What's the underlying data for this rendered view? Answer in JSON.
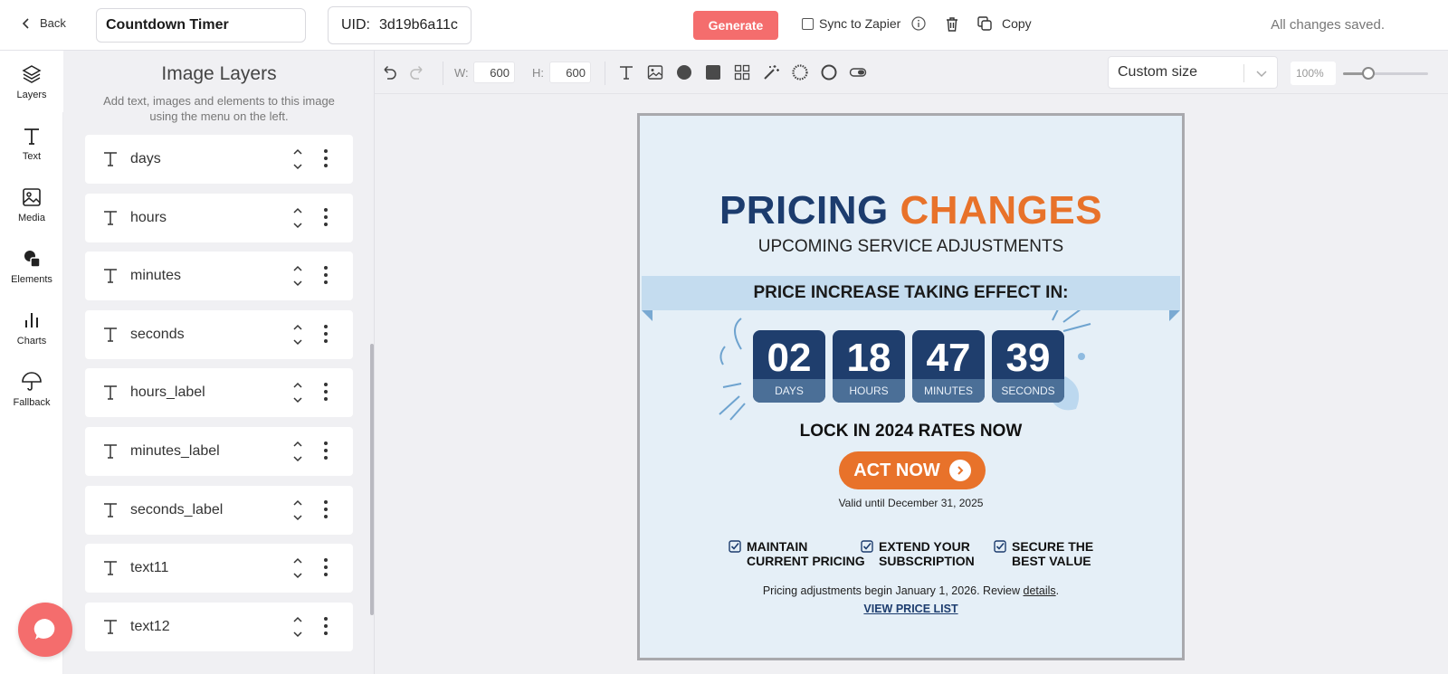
{
  "topbar": {
    "back_label": "Back",
    "project_title": "Countdown Timer",
    "uid_label": "UID:",
    "uid_value": "3d19b6a11c",
    "generate_label": "Generate",
    "zapier_label": "Sync to Zapier",
    "copy_label": "Copy",
    "status": "All changes saved.",
    "accent_color": "#f46d6d"
  },
  "rail": {
    "items": [
      {
        "label": "Layers",
        "icon": "layers-icon"
      },
      {
        "label": "Text",
        "icon": "text-icon"
      },
      {
        "label": "Media",
        "icon": "image-icon"
      },
      {
        "label": "Elements",
        "icon": "shapes-icon"
      },
      {
        "label": "Charts",
        "icon": "bar-chart-icon"
      },
      {
        "label": "Fallback",
        "icon": "umbrella-icon"
      }
    ]
  },
  "panel": {
    "title": "Image Layers",
    "subtitle": "Add text, images and elements to this image using the menu on the left.",
    "layers": [
      {
        "name": "days"
      },
      {
        "name": "hours"
      },
      {
        "name": "minutes"
      },
      {
        "name": "seconds"
      },
      {
        "name": "hours_label"
      },
      {
        "name": "minutes_label"
      },
      {
        "name": "seconds_label"
      },
      {
        "name": "text11"
      },
      {
        "name": "text12"
      }
    ]
  },
  "toolbar": {
    "width_label": "W:",
    "width_value": "600",
    "height_label": "H:",
    "height_value": "600",
    "size_preset": "Custom size",
    "zoom": "100%",
    "zoom_level": 0.3
  },
  "canvas": {
    "title_part1": "PRICING",
    "title_part2": "CHANGES",
    "subtitle": "UPCOMING SERVICE ADJUSTMENTS",
    "banner": "PRICE INCREASE TAKING EFFECT IN:",
    "timer": [
      {
        "value": "02",
        "unit": "DAYS"
      },
      {
        "value": "18",
        "unit": "HOURS"
      },
      {
        "value": "47",
        "unit": "MINUTES"
      },
      {
        "value": "39",
        "unit": "SECONDS"
      }
    ],
    "lock_text": "LOCK IN 2024 RATES NOW",
    "cta": "ACT NOW",
    "valid": "Valid until December 31, 2025",
    "benefits": [
      {
        "line1": "MAINTAIN",
        "line2": "CURRENT PRICING"
      },
      {
        "line1": "EXTEND YOUR",
        "line2": "SUBSCRIPTION"
      },
      {
        "line1": "SECURE THE",
        "line2": "BEST VALUE"
      }
    ],
    "footer_text": "Pricing adjustments begin January 1, 2026. Review",
    "footer_link": "details",
    "footer_end": ".",
    "view_list": "VIEW PRICE LIST",
    "colors": {
      "navy": "#1c3c6e",
      "orange": "#e8722a",
      "background": "#e5eff7"
    }
  }
}
